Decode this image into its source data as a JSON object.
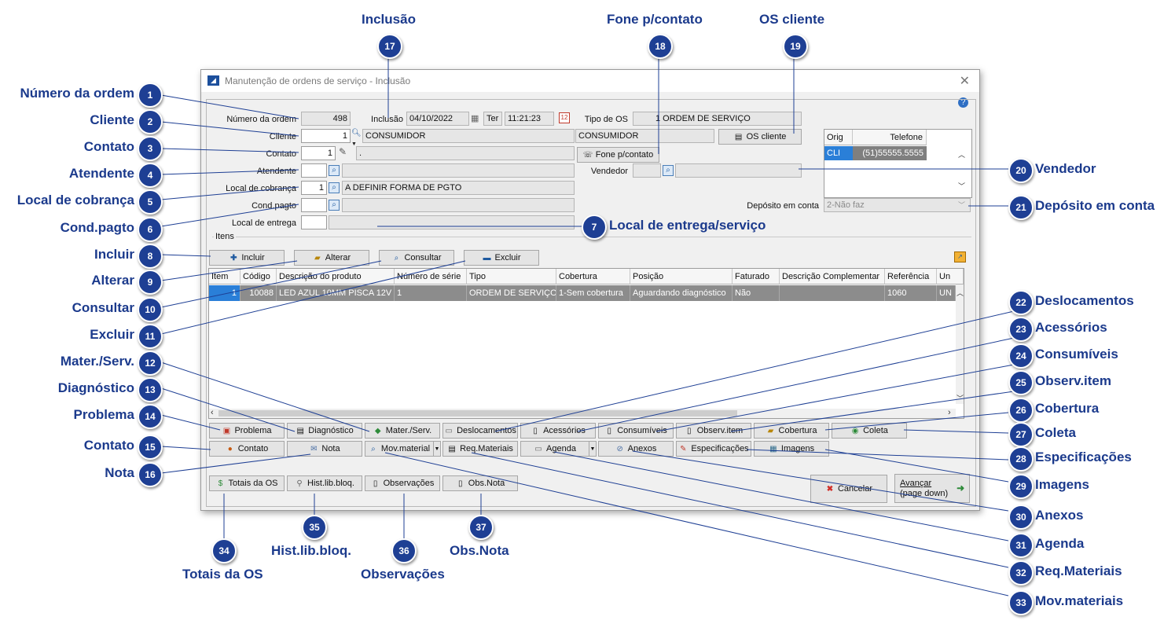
{
  "window": {
    "title": "Manutenção de ordens de serviço - Inclusão",
    "close_label": "✕",
    "help_label": "?"
  },
  "header": {
    "numero_label": "Número da ordem",
    "numero_value": "498",
    "inclusao_label": "Inclusão",
    "inclusao_date": "04/10/2022",
    "inclusao_day": "Ter",
    "inclusao_time": "11:21:23",
    "tipo_label": "Tipo de OS",
    "tipo_value": "1 ORDEM DE SERVIÇO",
    "cliente_label": "Cliente",
    "cliente_code": "1",
    "cliente_name": "CONSUMIDOR",
    "cliente_name2": "CONSUMIDOR",
    "contato_label": "Contato",
    "contato_code": "1",
    "contato_name": ".",
    "atendente_label": "Atendente",
    "local_cobranca_label": "Local de cobrança",
    "local_cobranca_code": "1",
    "local_cobranca_name": "A DEFINIR FORMA DE PGTO",
    "cond_pagto_label": "Cond.pagto",
    "local_entrega_label": "Local de entrega",
    "vendedor_label": "Vendedor",
    "deposito_label": "Depósito em conta",
    "deposito_value": "2-Não faz",
    "os_cliente_button": "OS cliente",
    "fone_button": "Fone p/contato"
  },
  "phones": {
    "headers": [
      "Orig",
      "Telefone"
    ],
    "rows": [
      [
        "CLI",
        "(51)55555.5555"
      ]
    ]
  },
  "items": {
    "group_label": "Itens",
    "buttons": {
      "incluir": "Incluir",
      "alterar": "Alterar",
      "consultar": "Consultar",
      "excluir": "Excluir"
    },
    "columns": [
      "Item",
      "Código",
      "Descrição do produto",
      "Número de série",
      "Tipo",
      "Cobertura",
      "Posição",
      "Faturado",
      "Descrição Complementar",
      "Referência",
      "Un"
    ],
    "rows": [
      [
        "1",
        "10088",
        "LED AZUL 10MM PISCA 12V",
        "1",
        "ORDEM DE SERVIÇO",
        "1-Sem cobertura",
        "Aguardando diagnóstico",
        "Não",
        "",
        "1060",
        "UN"
      ]
    ]
  },
  "tabs_row1": [
    "Problema",
    "Diagnóstico",
    "Mater./Serv.",
    "Deslocamentos",
    "Acessórios",
    "Consumíveis",
    "Observ.item",
    "Cobertura",
    "Coleta"
  ],
  "tabs_row2": [
    "Contato",
    "Nota",
    "Mov.material",
    "Req.Materiais",
    "Agenda",
    "Anexos",
    "Especificações",
    "Imagens"
  ],
  "bottom_buttons": [
    "Totais da OS",
    "Hist.lib.bloq.",
    "Observações",
    "Obs.Nota"
  ],
  "cancel_button": "Cancelar",
  "next_button": {
    "line1": "Avançar",
    "line2": "(page down)"
  },
  "callouts": [
    {
      "n": "1",
      "label": "Número da ordem"
    },
    {
      "n": "2",
      "label": "Cliente"
    },
    {
      "n": "3",
      "label": "Contato"
    },
    {
      "n": "4",
      "label": "Atendente"
    },
    {
      "n": "5",
      "label": "Local de cobrança"
    },
    {
      "n": "6",
      "label": "Cond.pagto"
    },
    {
      "n": "7",
      "label": "Local de entrega/serviço"
    },
    {
      "n": "8",
      "label": "Incluir"
    },
    {
      "n": "9",
      "label": "Alterar"
    },
    {
      "n": "10",
      "label": "Consultar"
    },
    {
      "n": "11",
      "label": "Excluir"
    },
    {
      "n": "12",
      "label": "Mater./Serv."
    },
    {
      "n": "13",
      "label": "Diagnóstico"
    },
    {
      "n": "14",
      "label": "Problema"
    },
    {
      "n": "15",
      "label": "Contato"
    },
    {
      "n": "16",
      "label": "Nota"
    },
    {
      "n": "17",
      "label": "Inclusão"
    },
    {
      "n": "18",
      "label": "Fone p/contato"
    },
    {
      "n": "19",
      "label": "OS cliente"
    },
    {
      "n": "20",
      "label": "Vendedor"
    },
    {
      "n": "21",
      "label": "Depósito em conta"
    },
    {
      "n": "22",
      "label": "Deslocamentos"
    },
    {
      "n": "23",
      "label": "Acessórios"
    },
    {
      "n": "24",
      "label": "Consumíveis"
    },
    {
      "n": "25",
      "label": "Observ.item"
    },
    {
      "n": "26",
      "label": "Cobertura"
    },
    {
      "n": "27",
      "label": "Coleta"
    },
    {
      "n": "28",
      "label": "Especificações"
    },
    {
      "n": "29",
      "label": "Imagens"
    },
    {
      "n": "30",
      "label": "Anexos"
    },
    {
      "n": "31",
      "label": "Agenda"
    },
    {
      "n": "32",
      "label": "Req.Materiais"
    },
    {
      "n": "33",
      "label": "Mov.materiais"
    },
    {
      "n": "34",
      "label": "Totais da OS"
    },
    {
      "n": "35",
      "label": "Hist.lib.bloq."
    },
    {
      "n": "36",
      "label": "Observações"
    },
    {
      "n": "37",
      "label": "Obs.Nota"
    }
  ]
}
